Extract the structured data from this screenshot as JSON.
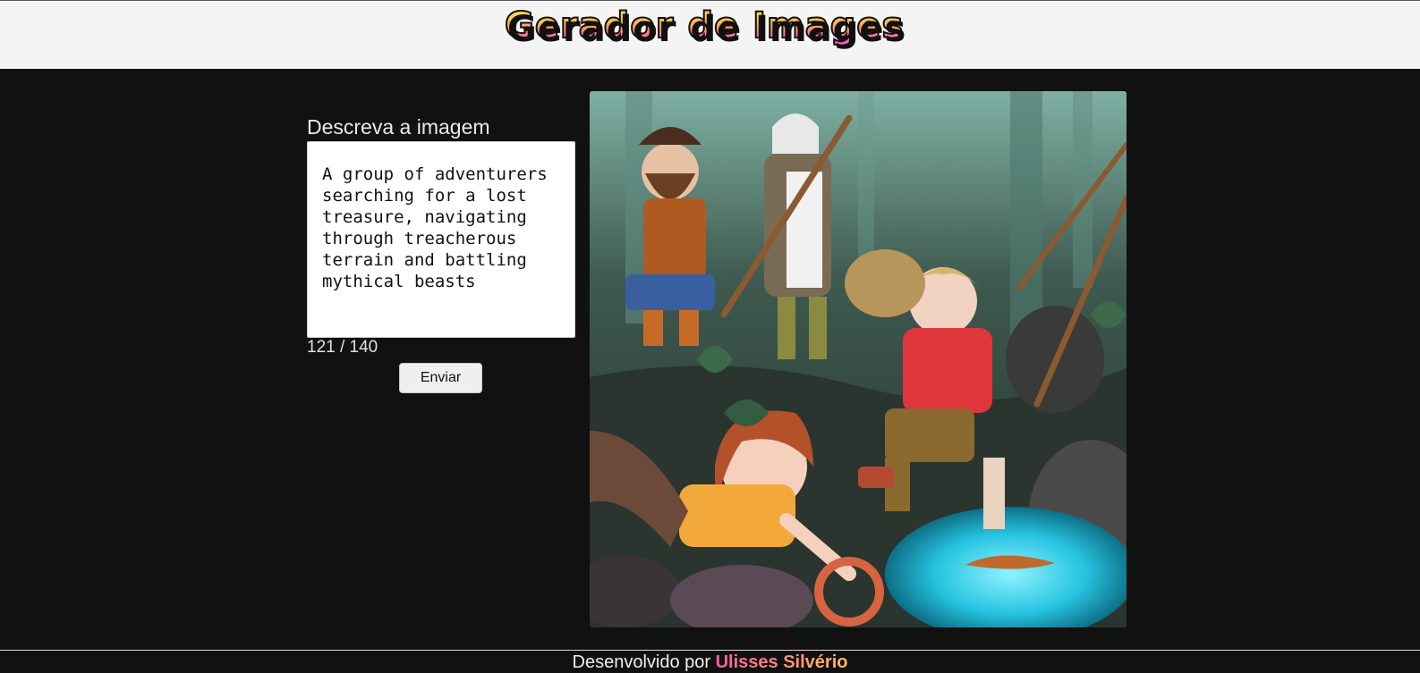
{
  "header": {
    "title": "Gerador de Images"
  },
  "form": {
    "label": "Descreva a imagem",
    "prompt_value": "A group of adventurers searching for a lost treasure, navigating through treacherous terrain and battling mythical beasts",
    "char_count": "121 / 140",
    "submit_label": "Enviar"
  },
  "result": {
    "description": "Illustration of adventurers in a misty forest by a glowing pool"
  },
  "footer": {
    "prefix": "Desenvolvido por",
    "author": "Ulisses Silvério"
  },
  "colors": {
    "page_bg": "#111111",
    "header_bg": "#f4f4f4",
    "logo_gradient_top": "#ffe94a",
    "logo_gradient_bottom": "#e24bd0",
    "author_gradient_start": "#ff5fa8",
    "author_gradient_end": "#ffc15a"
  }
}
